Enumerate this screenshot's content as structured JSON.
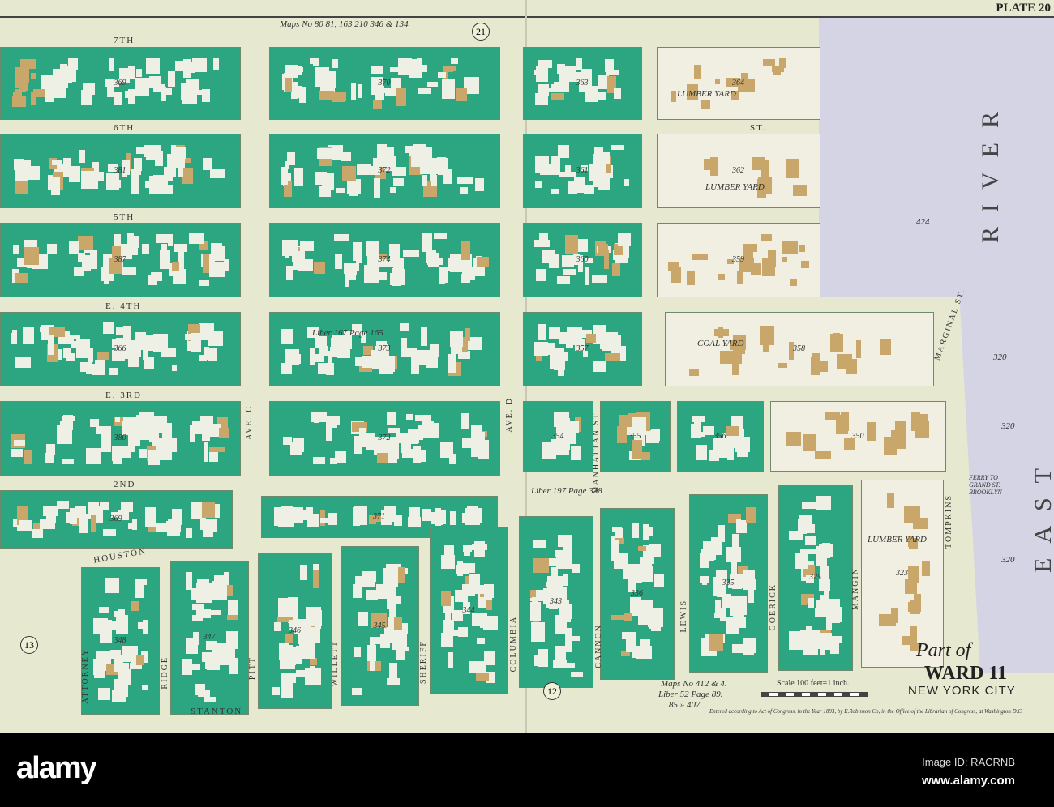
{
  "plate": "PLATE 20",
  "maps_ref_top": "Maps No 80 81, 163 210 346 & 134",
  "sheet_numbers": {
    "top": "21",
    "bottom_mid": "12",
    "bottom_left": "13"
  },
  "streets_horizontal": [
    "7TH",
    "6TH",
    "5TH",
    "E. 4TH",
    "E. 3RD",
    "2ND",
    "ST.",
    "HOUSTON",
    "STANTON",
    "MARGINAL ST."
  ],
  "streets_vertical": [
    "AVE. C",
    "AVE. D",
    "ATTORNEY",
    "RIDGE",
    "PITT",
    "WILLETT",
    "SHERIFF",
    "COLUMBIA",
    "CANNON",
    "LEWIS",
    "GOERICK",
    "MANGIN",
    "TOMPKINS",
    "MANHATTAN ST."
  ],
  "river_labels": {
    "river": "RIVER",
    "east": "EAST"
  },
  "liber_notes": [
    "Liber 167 Page 165",
    "Liber 197 Page 338"
  ],
  "yard_labels": [
    "LUMBER YARD",
    "LUMBER YARD",
    "COAL YARD",
    "LUMBER YARD",
    "FERRY TO GRAND ST. BROOKLYN"
  ],
  "pier_numbers": [
    "320",
    "320",
    "320",
    "424"
  ],
  "blocks": [
    "369",
    "370",
    "363",
    "364",
    "381",
    "372",
    "361",
    "362",
    "387",
    "374",
    "360",
    "359",
    "366",
    "373",
    "357",
    "358",
    "380",
    "372",
    "354",
    "355",
    "356",
    "350",
    "369",
    "371",
    "348",
    "347",
    "346",
    "345",
    "344",
    "343",
    "336",
    "335",
    "325",
    "323"
  ],
  "title": {
    "part": "Part of",
    "ward": "WARD 11",
    "city": "NEW YORK CITY"
  },
  "maps_ref_bottom": [
    "Maps No 412 & 4.",
    "Liber 52  Page 89.",
    "85  »  407."
  ],
  "scale": "Scale 100 feet=1 inch.",
  "copyright": "Entered according to Act of Congress, in the Year 1893, by E.Robinson Co, in the Office of the Librarian of Congress, at Washington D.C.",
  "watermark": {
    "logo": "alamy",
    "image_id": "Image ID: RACRNB",
    "url": "www.alamy.com"
  },
  "colors": {
    "paper": "#e6e8cf",
    "building": "#2ba680",
    "frame_building": "#c9a76a",
    "river": "#d5d4e4"
  }
}
